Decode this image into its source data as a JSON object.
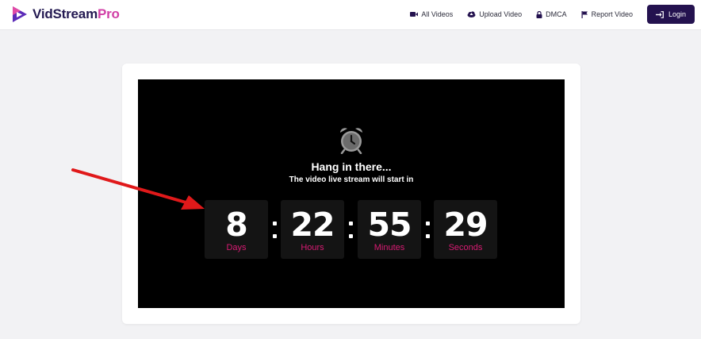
{
  "brand": {
    "name": "VidStream",
    "suffix": "Pro"
  },
  "nav": {
    "all_videos": "All Videos",
    "upload_video": "Upload Video",
    "dmca": "DMCA",
    "report_video": "Report Video",
    "login": "Login"
  },
  "player": {
    "headline": "Hang in there...",
    "subline": "The video live stream will start in"
  },
  "countdown": [
    {
      "value": "8",
      "label": "Days"
    },
    {
      "value": "22",
      "label": "Hours"
    },
    {
      "value": "55",
      "label": "Minutes"
    },
    {
      "value": "29",
      "label": "Seconds"
    }
  ],
  "colors": {
    "brand_dark": "#24124f",
    "brand_pink": "#d13fa6",
    "countdown_label": "#d81b73",
    "annotation_arrow": "#e0191a"
  },
  "icons": [
    "play-logo-icon",
    "video-icon",
    "cloud-upload-icon",
    "lock-icon",
    "flag-icon",
    "login-icon",
    "alarm-clock-icon",
    "annotation-arrow"
  ]
}
